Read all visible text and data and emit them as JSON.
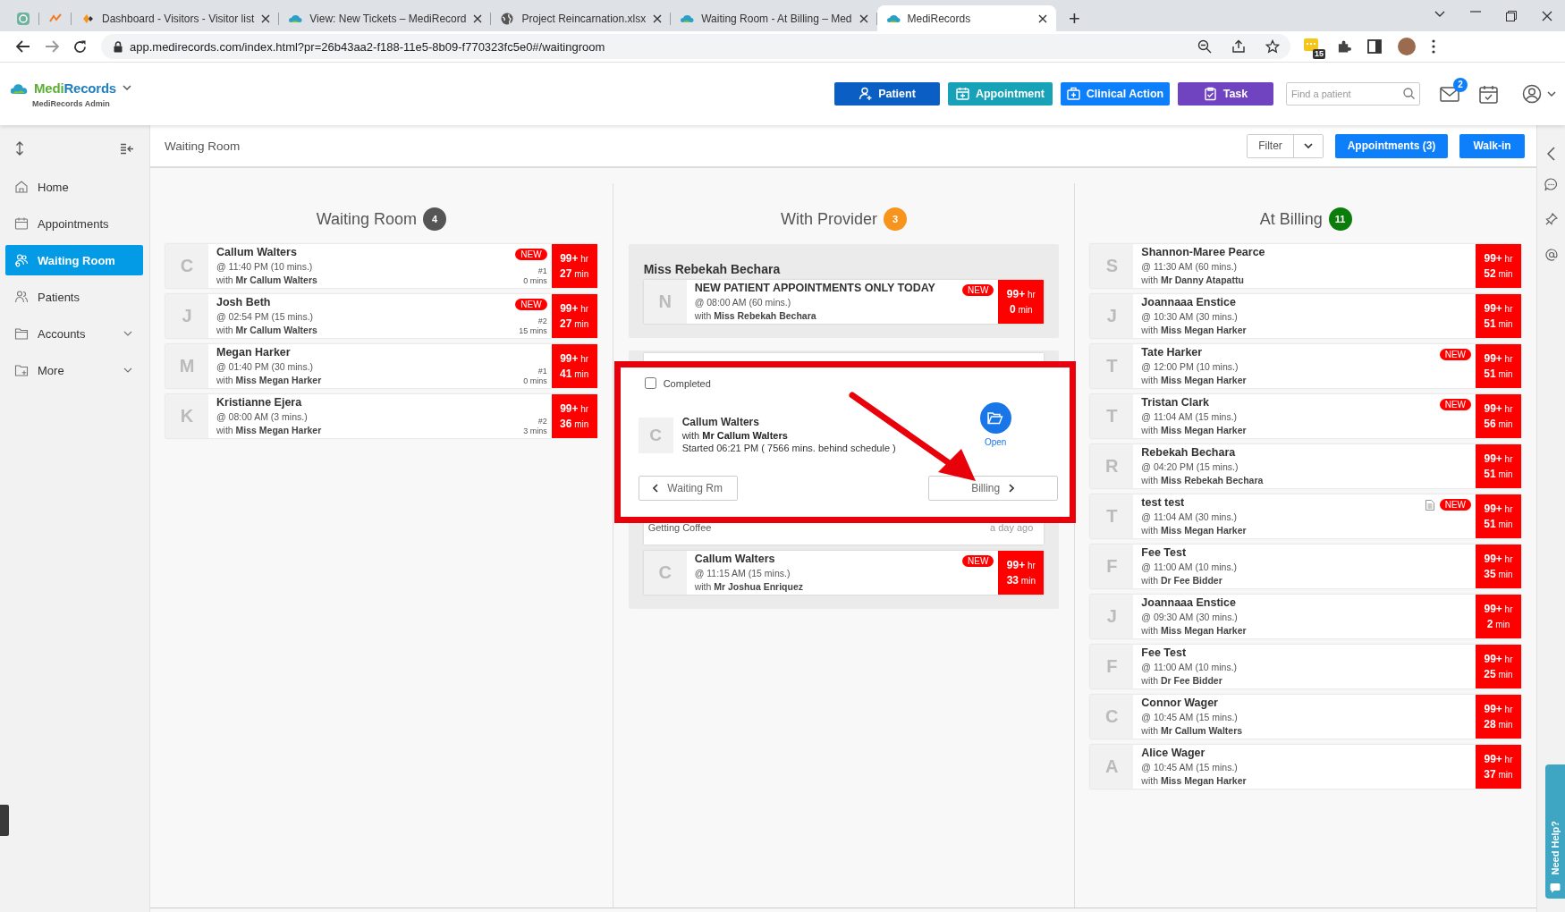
{
  "browser": {
    "tabs": [
      {
        "kind": "pinned",
        "selected": false
      },
      {
        "kind": "pinned",
        "selected": false
      },
      {
        "kind": "page",
        "title": "Dashboard - Visitors - Visitor list",
        "selected": false
      },
      {
        "kind": "page",
        "title": "View: New Tickets – MediRecord",
        "selected": false
      },
      {
        "kind": "page",
        "title": "Project Reincarnation.xlsx",
        "selected": false
      },
      {
        "kind": "page",
        "title": "Waiting Room - At Billing – Med",
        "selected": false
      },
      {
        "kind": "page",
        "title": "MediRecords",
        "selected": true
      }
    ],
    "new_tab": "+",
    "address": "app.medirecords.com/index.html?pr=26b43aa2-f188-11e5-8b09-f770323fc5e0#/waitingroom",
    "extension_badge": "15"
  },
  "header": {
    "logo": [
      "Medi",
      "Records"
    ],
    "subtitle": "MediRecords Admin",
    "actions": [
      {
        "label": "Patient",
        "color": "#0b5fc4"
      },
      {
        "label": "Appointment",
        "color": "#17a2b8"
      },
      {
        "label": "Clinical Action",
        "color": "#0d7ffa"
      },
      {
        "label": "Task",
        "color": "#7043c0"
      }
    ],
    "search": {
      "placeholder": "Find a patient"
    },
    "mail_count": "2"
  },
  "sidebar": {
    "items": [
      {
        "label": "Home",
        "selected": false,
        "expandable": false
      },
      {
        "label": "Appointments",
        "selected": false,
        "expandable": false
      },
      {
        "label": "Waiting Room",
        "selected": true,
        "expandable": false
      },
      {
        "label": "Patients",
        "selected": false,
        "expandable": false
      },
      {
        "label": "Accounts",
        "selected": false,
        "expandable": true
      },
      {
        "label": "More",
        "selected": false,
        "expandable": true
      }
    ]
  },
  "page_header": {
    "title": "Waiting Room",
    "filter": "Filter",
    "buttons": [
      "Appointments (3)",
      "Walk-in"
    ]
  },
  "board": {
    "waiting_room": {
      "title": "Waiting Room",
      "count": "4",
      "color": "#555555",
      "cards": [
        {
          "initial": "C",
          "name": "Callum Walters",
          "time": "@ 11:40 PM (10 mins.)",
          "with": "with **Mr Callum Walters**",
          "badge": "NEW",
          "queue": "#1",
          "wait": "0 mins",
          "hours": "**99+** hr",
          "minutes": "**27** min"
        },
        {
          "initial": "J",
          "name": "Josh Beth",
          "time": "@ 02:54 PM (15 mins.)",
          "with": "with **Mr Callum Walters**",
          "badge": "NEW",
          "queue": "#2",
          "wait": "15 mins",
          "hours": "**99+** hr",
          "minutes": "**27** min"
        },
        {
          "initial": "M",
          "name": "Megan Harker",
          "time": "@ 01:40 PM (30 mins.)",
          "with": "with **Miss Megan Harker**",
          "queue": "#1",
          "wait": "0 mins",
          "hours": "**99+** hr",
          "minutes": "**41** min"
        },
        {
          "initial": "K",
          "name": "Kristianne Ejera",
          "time": "@ 08:00 AM (3 mins.)",
          "with": "with **Miss Megan Harker**",
          "queue": "#2",
          "wait": "3 mins",
          "hours": "**99+** hr",
          "minutes": "**36** min"
        }
      ]
    },
    "with_provider": {
      "title": "With Provider",
      "count": "3",
      "color": "#f7941d",
      "groups": [
        {
          "provider": "Miss Rebekah Bechara",
          "cards": [
            {
              "initial": "N",
              "name": "NEW PATIENT APPOINTMENTS ONLY TODAY",
              "time": "@ 08:00 AM (60 mins.)",
              "with": "with **Miss Rebekah Bechara**",
              "badge": "NEW",
              "hours": "**99+** hr",
              "minutes": "**0** min"
            }
          ]
        },
        {
          "note": {
            "text": "Getting Coffee",
            "time": "a day ago"
          },
          "cards": [
            {
              "initial": "C",
              "name": "Callum Walters",
              "time": "@ 11:15 AM (15 mins.)",
              "with": "with **Mr Joshua Enriquez**",
              "badge": "NEW",
              "hours": "**99+** hr",
              "minutes": "**33** min"
            }
          ]
        }
      ]
    },
    "at_billing": {
      "title": "At Billing",
      "count": "11",
      "color": "#0a7d0a",
      "cards": [
        {
          "initial": "S",
          "name": "Shannon-Maree Pearce",
          "time": "@ 11:30 AM (60 mins.)",
          "with": "with **Mr Danny Atapattu**",
          "document": false,
          "hours": "**99+** hr",
          "minutes": "**52** min"
        },
        {
          "initial": "J",
          "name": "Joannaaa Enstice",
          "time": "@ 10:30 AM (30 mins.)",
          "with": "with **Miss Megan Harker**",
          "document": false,
          "hours": "**99+** hr",
          "minutes": "**51** min"
        },
        {
          "initial": "T",
          "name": "Tate Harker",
          "time": "@ 12:00 PM (10 mins.)",
          "with": "with **Miss Megan Harker**",
          "badge": "NEW",
          "document": false,
          "hours": "**99+** hr",
          "minutes": "**51** min"
        },
        {
          "initial": "T",
          "name": "Tristan Clark",
          "time": "@ 11:04 AM (15 mins.)",
          "with": "with **Miss Megan Harker**",
          "badge": "NEW",
          "document": false,
          "hours": "**99+** hr",
          "minutes": "**56** min"
        },
        {
          "initial": "R",
          "name": "Rebekah Bechara",
          "time": "@ 04:20 PM (15 mins.)",
          "with": "with **Miss Rebekah Bechara**",
          "document": false,
          "hours": "**99+** hr",
          "minutes": "**51** min"
        },
        {
          "initial": "T",
          "name": "test test",
          "time": "@ 11:04 AM (30 mins.)",
          "with": "with **Miss Megan Harker**",
          "badge": "NEW",
          "document": true,
          "hours": "**99+** hr",
          "minutes": "**51** min"
        },
        {
          "initial": "F",
          "name": "Fee Test",
          "time": "@ 11:00 AM (10 mins.)",
          "with": "with **Dr Fee Bidder**",
          "document": false,
          "hours": "**99+** hr",
          "minutes": "**35** min"
        },
        {
          "initial": "J",
          "name": "Joannaaa Enstice",
          "time": "@ 09:30 AM (30 mins.)",
          "with": "with **Miss Megan Harker**",
          "document": false,
          "hours": "**99+** hr",
          "minutes": "**2** min"
        },
        {
          "initial": "F",
          "name": "Fee Test",
          "time": "@ 11:00 AM (10 mins.)",
          "with": "with **Dr Fee Bidder**",
          "document": false,
          "hours": "**99+** hr",
          "minutes": "**25** min"
        },
        {
          "initial": "C",
          "name": "Connor Wager",
          "time": "@ 10:45 AM (15 mins.)",
          "with": "with **Mr Callum Walters**",
          "document": false,
          "hours": "**99+** hr",
          "minutes": "**28** min"
        },
        {
          "initial": "A",
          "name": "Alice Wager",
          "time": "@ 10:45 AM (15 mins.)",
          "with": "with **Miss Megan Harker**",
          "document": false,
          "hours": "**99+** hr",
          "minutes": "**37** min"
        }
      ]
    }
  },
  "popup": {
    "completed_label": "Completed",
    "completed": false,
    "initial": "C",
    "name": "Callum Walters",
    "with": "with **Mr Callum Walters**",
    "started": "Started 06:21 PM ( 7566 mins. behind schedule )",
    "open_label": "Open",
    "back_button": "Waiting Rm",
    "forward_button": "Billing"
  },
  "help_tab": "Need Help?"
}
